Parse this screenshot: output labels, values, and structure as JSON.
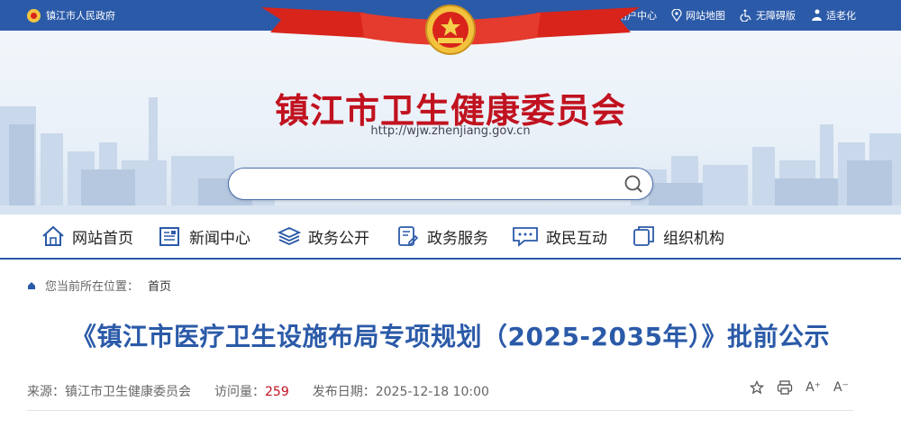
{
  "topbar": {
    "site_name": "镇江市人民政府",
    "links": [
      "用户中心",
      "网站地图",
      "无障碍版",
      "适老化"
    ]
  },
  "banner": {
    "title": "镇江市卫生健康委员会",
    "url": "http://wjw.zhenjiang.gov.cn",
    "search_placeholder": ""
  },
  "nav": [
    "网站首页",
    "新闻中心",
    "政务公开",
    "政务服务",
    "政民互动",
    "组织机构"
  ],
  "breadcrumb": {
    "label": "您当前所在位置：",
    "current": "首页"
  },
  "article": {
    "title": "《镇江市医疗卫生设施布局专项规划（2025-2035年）》批前公示",
    "source_label": "来源：镇江市卫生健康委员会",
    "views_label": "访问量：",
    "views": "259",
    "date_label": "发布日期：2025-12-18 10:00"
  },
  "tools": {
    "font_larger": "A⁺",
    "font_smaller": "A⁻"
  },
  "colors": {
    "topbar": "#2b5aa8",
    "title_red": "#c1121f",
    "article_blue": "#2b5aa8"
  }
}
